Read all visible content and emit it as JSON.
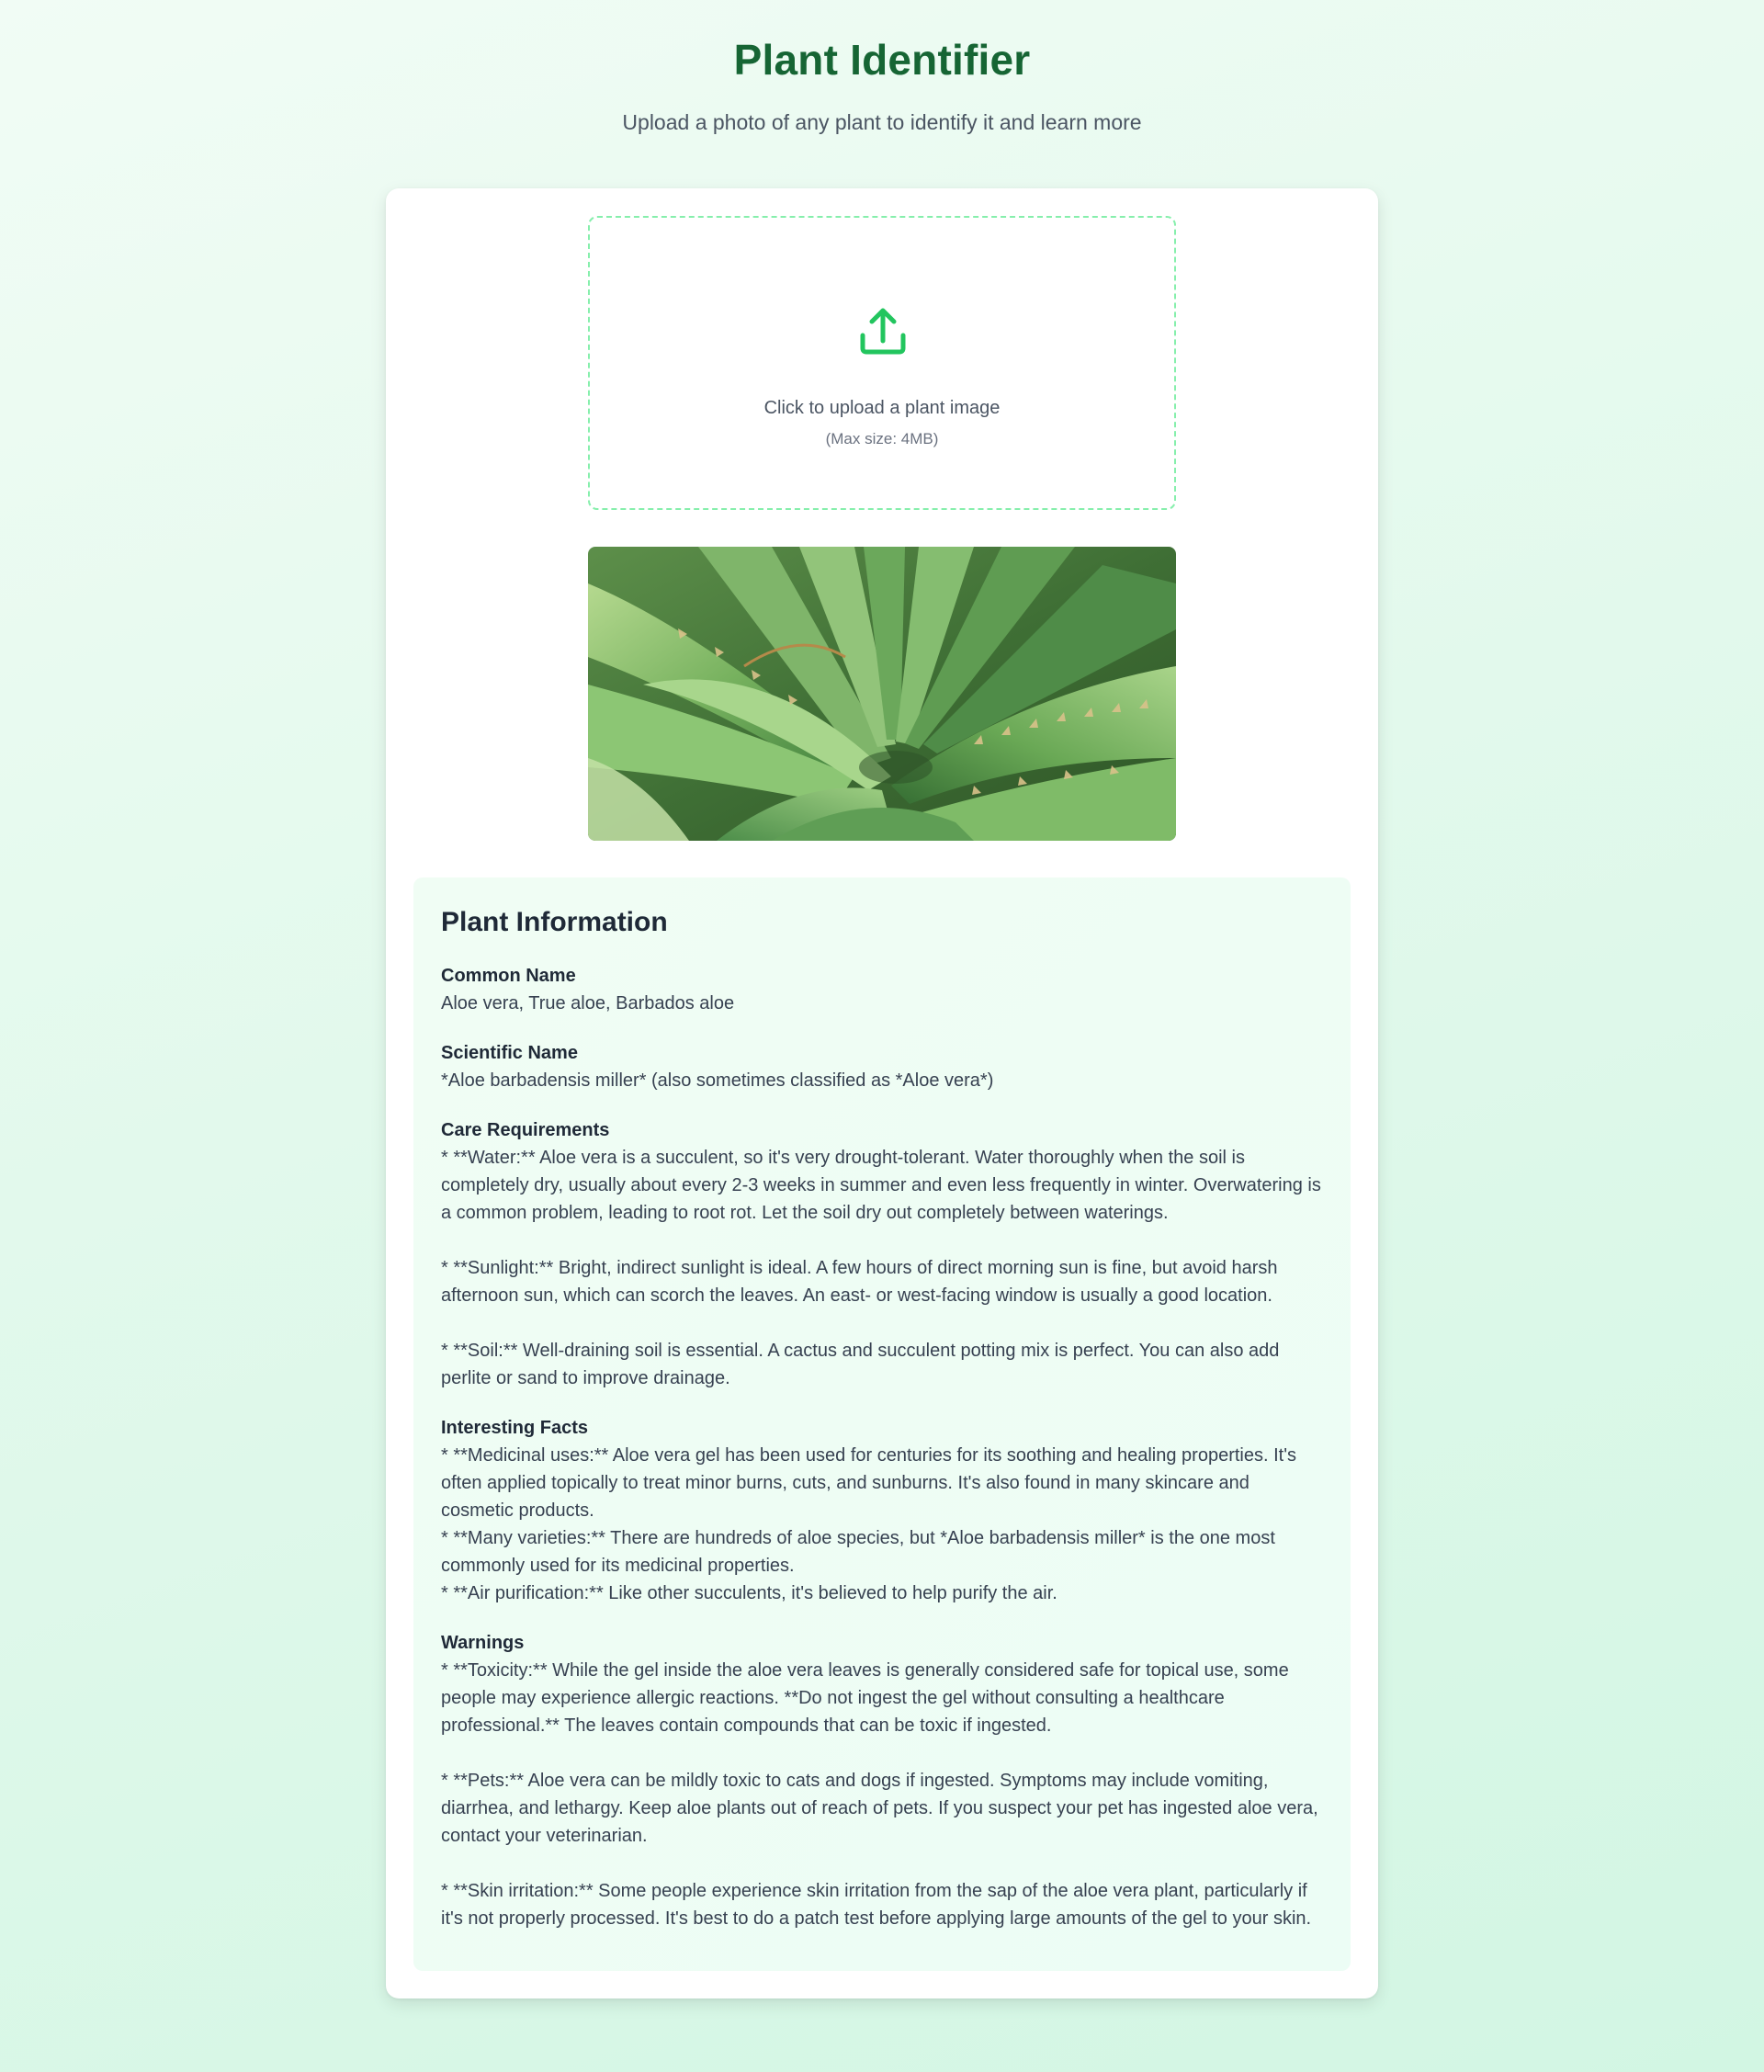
{
  "header": {
    "title": "Plant Identifier",
    "subtitle": "Upload a photo of any plant to identify it and learn more"
  },
  "upload": {
    "icon": "upload-icon",
    "text": "Click to upload a plant image",
    "hint": "(Max size: 4MB)"
  },
  "preview": {
    "subject": "aloe vera plant photo"
  },
  "colors": {
    "title_green": "#166534",
    "accent_green": "#22c55e",
    "dashed_border": "#86efac",
    "panel_bg": "#f0fdf4"
  },
  "info": {
    "title": "Plant Information",
    "common_name": {
      "label": "Common Name",
      "value": "Aloe vera, True aloe, Barbados aloe"
    },
    "scientific_name": {
      "label": "Scientific Name",
      "value": "*Aloe barbadensis miller* (also sometimes classified as *Aloe vera*)"
    },
    "care": {
      "label": "Care Requirements",
      "value": "* **Water:**  Aloe vera is a succulent, so it's very drought-tolerant. Water thoroughly when the soil is completely dry, usually about every 2-3 weeks in summer and even less frequently in winter. Overwatering is a common problem, leading to root rot.  Let the soil dry out completely between waterings.\n\n    * **Sunlight:**  Bright, indirect sunlight is ideal.  A few hours of direct morning sun is fine, but avoid harsh afternoon sun, which can scorch the leaves.  An east- or west-facing window is usually a good location.\n\n    * **Soil:** Well-draining soil is essential. A cactus and succulent potting mix is perfect. You can also add perlite or sand to improve drainage."
    },
    "facts": {
      "label": "Interesting Facts",
      "value": "* **Medicinal uses:** Aloe vera gel has been used for centuries for its soothing and healing properties. It's often applied topically to treat minor burns, cuts, and sunburns. It's also found in many skincare and cosmetic products.\n    * **Many varieties:**  There are hundreds of aloe species, but *Aloe barbadensis miller* is the one most commonly used for its medicinal properties.\n    * **Air purification:** Like other succulents, it's believed to help purify the air."
    },
    "warnings": {
      "label": "Warnings",
      "value": "* **Toxicity:** While the gel inside the aloe vera leaves is generally considered safe for topical use, some people may experience allergic reactions.  **Do not ingest the gel without consulting a healthcare professional.**  The leaves contain compounds that can be toxic if ingested.\n\n    * **Pets:**  Aloe vera can be mildly toxic to cats and dogs if ingested.  Symptoms may include vomiting, diarrhea, and lethargy.  Keep aloe plants out of reach of pets.  If you suspect your pet has ingested aloe vera, contact your veterinarian.\n\n    * **Skin irritation:** Some people experience skin irritation from the sap of the aloe vera plant, particularly if it's not properly processed.  It's best to do a patch test before applying large amounts of the gel to your skin."
    }
  }
}
